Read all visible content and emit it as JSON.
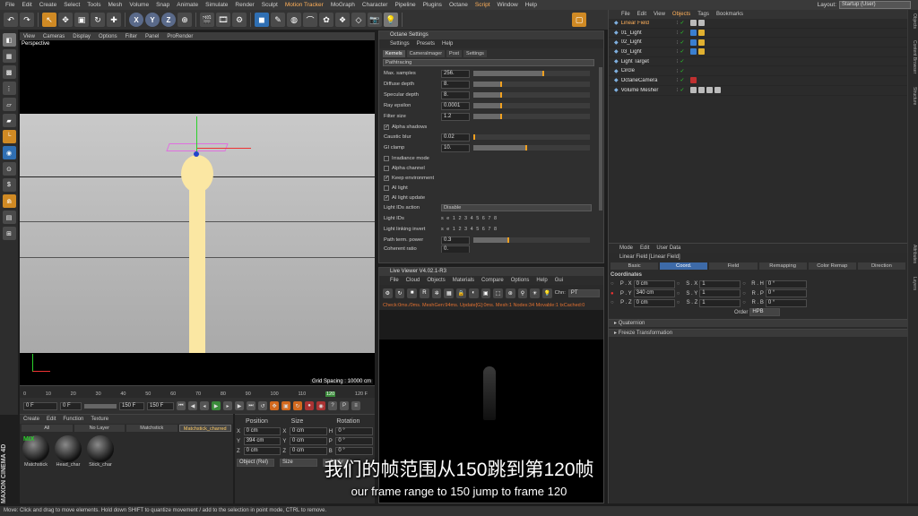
{
  "menubar": {
    "items": [
      "File",
      "Edit",
      "Create",
      "Select",
      "Tools",
      "Mesh",
      "Volume",
      "Snap",
      "Animate",
      "Simulate",
      "Render",
      "Sculpt",
      "Motion Tracker",
      "MoGraph",
      "Character",
      "Pipeline",
      "Plugins",
      "Octane",
      "Script",
      "Window",
      "Help"
    ],
    "layout_label": "Layout:",
    "layout_value": "Startup (User)"
  },
  "viewport": {
    "menu": [
      "View",
      "Cameras",
      "Display",
      "Options",
      "Filter",
      "Panel",
      "ProRender"
    ],
    "label": "Perspective",
    "grid_spacing": "Grid Spacing : 10000 cm"
  },
  "timeline": {
    "ticks": [
      "0",
      "10",
      "20",
      "30",
      "40",
      "50",
      "60",
      "70",
      "80",
      "90",
      "100",
      "110",
      "120"
    ],
    "current_frame_badge": "120 F"
  },
  "playback": {
    "start": "0 F",
    "min": "0 F",
    "max": "150 F",
    "end": "150 F"
  },
  "material_manager": {
    "menu": [
      "Create",
      "Edit",
      "Function",
      "Texture"
    ],
    "filter_tabs": [
      "All",
      "No Layer",
      "Matchstick",
      "Matchstick_charred"
    ],
    "selected_tab": "Matchstick_charred",
    "materials": [
      {
        "name": "Matchstick",
        "badge": "MIX"
      },
      {
        "name": "Head_char"
      },
      {
        "name": "Stick_char"
      }
    ]
  },
  "coordinates": {
    "headers": [
      "Position",
      "Size",
      "Rotation"
    ],
    "rows": [
      {
        "axis": "X",
        "pos": "0 cm",
        "size_axis": "X",
        "size": "0 cm",
        "rot_axis": "H",
        "rot": "0 °"
      },
      {
        "axis": "Y",
        "pos": "394 cm",
        "size_axis": "Y",
        "size": "0 cm",
        "rot_axis": "P",
        "rot": "0 °"
      },
      {
        "axis": "Z",
        "pos": "0 cm",
        "size_axis": "Z",
        "size": "0 cm",
        "rot_axis": "B",
        "rot": "0 °"
      }
    ],
    "mode": "Object (Rel)",
    "size_mode": "Size",
    "apply": "Apply"
  },
  "octane_settings": {
    "title": "Octane Settings",
    "menu": [
      "Settings",
      "Presets",
      "Help"
    ],
    "tabs": [
      "Kernels",
      "Cameralmager",
      "Post",
      "Settings"
    ],
    "kernel": "Pathtracing",
    "params": [
      {
        "label": "Max. samples",
        "value": "256.",
        "fill": 0.6
      },
      {
        "label": "Diffuse depth",
        "value": "8.",
        "fill": 0.24
      },
      {
        "label": "Specular depth",
        "value": "8.",
        "fill": 0.24
      },
      {
        "label": "Ray epsilon",
        "value": "0.0001",
        "fill": 0.24
      },
      {
        "label": "Filter size",
        "value": "1.2",
        "fill": 0.24
      }
    ],
    "chk_alpha_shadows": "Alpha shadows",
    "caustic_blur": {
      "label": "Caustic blur",
      "value": "0.02",
      "fill": 0.01
    },
    "gi_clamp": {
      "label": "GI clamp",
      "value": "10.",
      "fill": 0.45
    },
    "chk_irradiance": "Irradiance mode",
    "chk_alpha_channel": "Alpha channel",
    "chk_keep_env": "Keep environment",
    "chk_ai_light": "AI light",
    "chk_ai_light_update": "AI light update",
    "light_ids_action": {
      "label": "Light IDs action",
      "value": "Disable"
    },
    "light_ids_label": "Light IDs",
    "light_ids": "s e 1 2 3 4 5 6 7 8",
    "light_linking_label": "Light linking invert",
    "path_term": {
      "label": "Path term. power",
      "value": "0.3",
      "fill": 0.3
    },
    "coherent": {
      "label": "Coherent ratio",
      "value": "0."
    }
  },
  "live_viewer": {
    "title": "Live Viewer V4.02.1-R3",
    "menu": [
      "File",
      "Cloud",
      "Objects",
      "Materials",
      "Compare",
      "Options",
      "Help",
      "Gui"
    ],
    "chn_label": "Chn:",
    "chn_value": "PT",
    "status": "Check:0ms./0ms. MeshGen:94ms. Update[G]:0ms. Mesh:1 Nodes:34 Movable:1 txCached:0"
  },
  "object_manager": {
    "menu": [
      "File",
      "Edit",
      "View",
      "Objects",
      "Tags",
      "Bookmarks"
    ],
    "objects": [
      {
        "name": "Linear Field",
        "selected": true,
        "tags": [
          "w",
          "w"
        ]
      },
      {
        "name": "01_Light",
        "tags": [
          "b",
          "y"
        ]
      },
      {
        "name": "02_Light",
        "tags": [
          "b",
          "y"
        ]
      },
      {
        "name": "03_Light",
        "tags": [
          "b",
          "y"
        ]
      },
      {
        "name": "Light Target",
        "tags": []
      },
      {
        "name": "Circle",
        "tags": []
      },
      {
        "name": "OctaneCamera",
        "tags": [
          "r"
        ]
      },
      {
        "name": "Volume Mesher",
        "tags": [
          "w",
          "w",
          "w",
          "w"
        ]
      }
    ]
  },
  "attribute_manager": {
    "menu": [
      "Mode",
      "Edit",
      "User Data"
    ],
    "object_label": "Linear Field [Linear Field]",
    "tabs": [
      "Basic",
      "Coord.",
      "Field",
      "Remapping",
      "Color Remap",
      "Direction"
    ],
    "selected_tab": "Coord.",
    "section": "Coordinates",
    "rows": [
      {
        "p": "P . X",
        "pv": "0 cm",
        "s": "S . X",
        "sv": "1",
        "r": "R . H",
        "rv": "0 °"
      },
      {
        "p": "P . Y",
        "pv": "340 cm",
        "s": "S . Y",
        "sv": "1",
        "r": "R . P",
        "rv": "0 °"
      },
      {
        "p": "P . Z",
        "pv": "0 cm",
        "s": "S . Z",
        "sv": "1",
        "r": "R . B",
        "rv": "0 °"
      }
    ],
    "order_label": "Order",
    "order_value": "HPB",
    "quaternion": "Quaternion",
    "freeze": "Freeze Transformation"
  },
  "right_strip": [
    "Objects",
    "Content Browser",
    "Structure",
    "Attributes",
    "Layers"
  ],
  "status_bar": "Move: Click and drag to move elements. Hold down SHIFT to quantize movement / add to the selection in point mode, CTRL to remove.",
  "brand": "MAXON CINEMA 4D",
  "subtitles": {
    "cn": "我们的帧范围从150跳到第120帧",
    "en": "our frame range to 150 jump to frame 120"
  },
  "colors": {
    "accent": "#ffb05a",
    "selection": "#3d6aa8",
    "match": "#fbe7a3"
  }
}
